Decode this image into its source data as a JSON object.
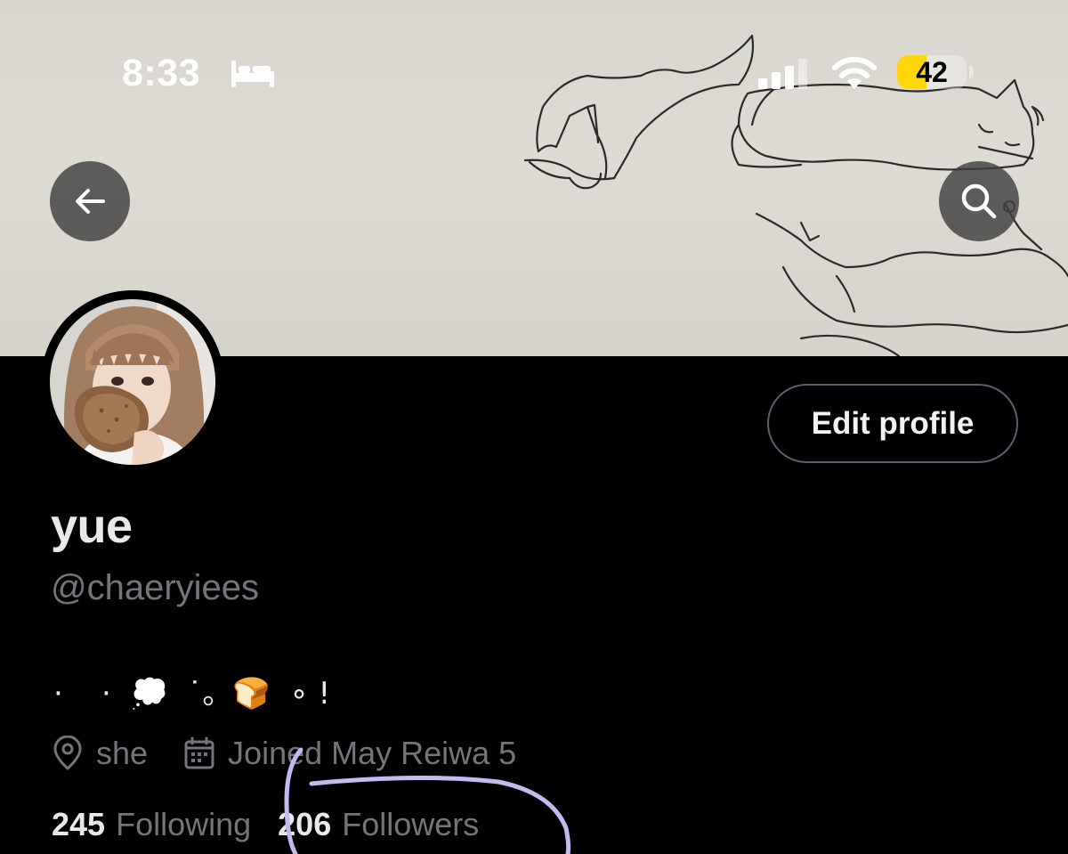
{
  "status_bar": {
    "time": "8:33",
    "battery_level": "42",
    "battery_fraction": 0.42,
    "icons": [
      "bed-icon",
      "cellular-signal-icon",
      "wifi-icon",
      "battery-icon"
    ]
  },
  "header": {
    "back_icon": "arrow-left-icon",
    "search_icon": "search-icon"
  },
  "profile": {
    "display_name": "yue",
    "handle": "@chaeryiees",
    "bio": "·    ·  💭  ˙。🍞  ∘ !",
    "location": "she",
    "location_icon": "map-pin-icon",
    "joined": "Joined May Reiwa 5",
    "joined_icon": "calendar-icon",
    "edit_button_label": "Edit profile",
    "following_count": "245",
    "following_label": "Following",
    "followers_count": "206",
    "followers_label": "Followers"
  },
  "colors": {
    "background": "#000000",
    "primary_text": "#e7e9ea",
    "secondary_text": "#71767b",
    "button_border": "#536471",
    "battery_fill": "#ffd60a",
    "annotation_stroke": "#c7b8f0"
  }
}
